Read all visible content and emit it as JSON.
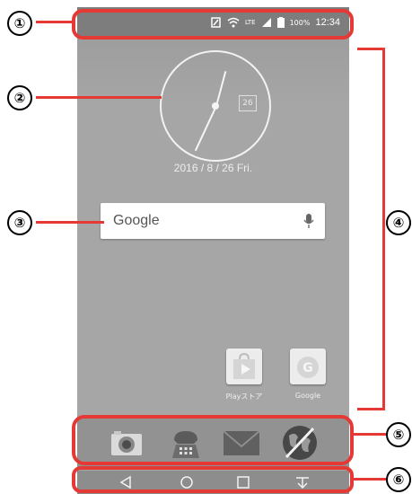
{
  "status_bar": {
    "time": "12:34",
    "battery_percent": "100%",
    "network": "LTE",
    "icons": [
      "nfc-icon",
      "wifi-icon",
      "lte-signal-icon",
      "battery-icon"
    ]
  },
  "clock_widget": {
    "date_badge": "26",
    "date_text": "2016 / 8 / 26 Fri."
  },
  "search_bar": {
    "logo_text": "Google",
    "icon": "mic-icon"
  },
  "home_apps": [
    {
      "label": "Playストア",
      "icon": "play-store-icon"
    },
    {
      "label": "Google",
      "icon": "google-icon"
    }
  ],
  "dock": {
    "icons": [
      "camera-icon",
      "phone-icon",
      "mail-icon",
      "browser-icon"
    ]
  },
  "nav_bar": {
    "icons": [
      "back-icon",
      "home-icon",
      "recents-icon",
      "notification-pull-icon"
    ]
  },
  "callouts": [
    "①",
    "②",
    "③",
    "④",
    "⑤",
    "⑥"
  ],
  "colors": {
    "callout_red": "#e53935",
    "wallpaper_gray": "#a6a6a6",
    "status_bar_gray": "#7d7d7d"
  }
}
